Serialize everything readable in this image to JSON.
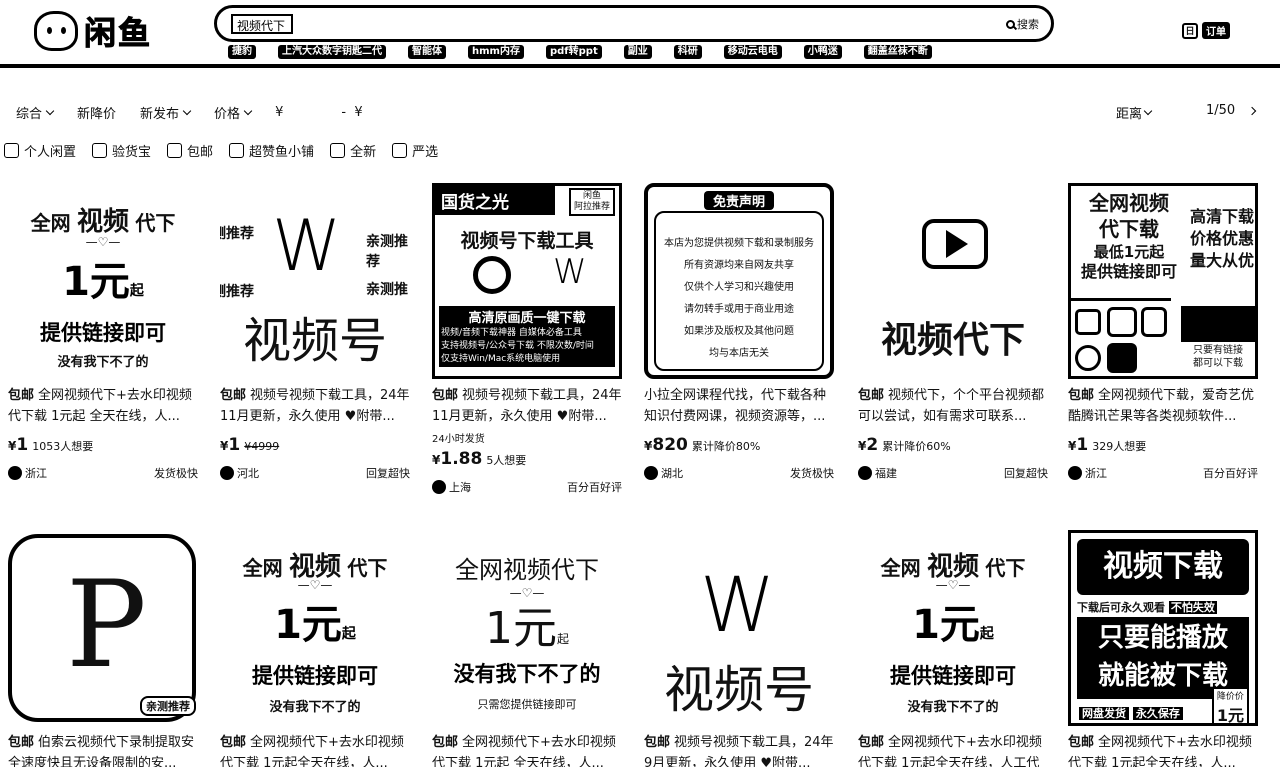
{
  "header": {
    "logo_text": "闲鱼",
    "search_value": "视频代下",
    "search_button": "搜索",
    "hot_words": [
      "捷豹",
      "上汽大众数字钥匙二代",
      "智能体",
      "hmm内存",
      "pdf转ppt",
      "副业",
      "科研",
      "移动云电电",
      "小鸭迷",
      "翻盖丝袜不断"
    ],
    "order_label": "订单"
  },
  "filters": {
    "sort_items": [
      "综合",
      "新降价",
      "新发布",
      "价格"
    ],
    "price_from": "¥",
    "price_sep": "-",
    "price_to": "¥",
    "distance": "距离",
    "page": "1/50",
    "checkboxes": [
      "个人闲置",
      "验货宝",
      "包邮",
      "超赞鱼小铺",
      "全新",
      "严选"
    ]
  },
  "products": [
    {
      "thumb": {
        "l1a": "全网",
        "l1b": "视频",
        "l1c": "代下",
        "l2": "1元",
        "l2s": "起",
        "l3": "提供链接即可",
        "l4": "没有我下不了的"
      },
      "tag": "包邮",
      "title": "全网视频代下+去水印视频代下载 1元起 全天在线，人...",
      "price": "1",
      "want": "1053人想要",
      "strike": "",
      "extra": "",
      "location": "浙江",
      "badge": "发货极快"
    },
    {
      "thumb": {
        "label1": "亲测推荐",
        "label2": "亲测推",
        "side1": "测推荐",
        "side2": "测推荐",
        "main": "视频号"
      },
      "tag": "包邮",
      "title": "视频号视频下载工具，24年11月更新，永久使用 ♥附带...",
      "price": "1",
      "want": "",
      "strike": "¥4999",
      "extra": "",
      "location": "河北",
      "badge": "回复超快"
    },
    {
      "thumb": {
        "top": "国货之光",
        "sub": "视频号下载工具",
        "hl": "高清原画质一键下载",
        "l1": "视频/音频下载神器 自媒体必备工具",
        "l2": "支持视频号/公众号下载 不限次数/时间",
        "l3": "仅支持Win/Mac系统电脑使用",
        "tag": "闲鱼",
        "tag2": "阿拉推荐"
      },
      "tag": "包邮",
      "title": "视频号视频下载工具，24年11月更新，永久使用 ♥附带...",
      "price": "1.88",
      "want": "5人想要",
      "strike": "",
      "extra": "24小时发货",
      "location": "上海",
      "badge": "百分百好评"
    },
    {
      "thumb": {
        "head": "免责声明",
        "lines": [
          "本店为您提供视频下载和录制服务",
          "所有资源均来自网友共享",
          "仅供个人学习和兴趣使用",
          "请勿转手或用于商业用途",
          "如果涉及版权及其他问题",
          "均与本店无关"
        ]
      },
      "tag": "",
      "title": "小拉全网课程代找，代下载各种知识付费网课，视频资源等，...",
      "price": "820",
      "want": "累计降价80%",
      "strike": "",
      "extra": "",
      "location": "湖北",
      "badge": "发货极快"
    },
    {
      "thumb": {
        "main": "视频代下"
      },
      "tag": "包邮",
      "title": "视频代下，个个平台视频都可以尝试，如有需求可联系...",
      "price": "2",
      "want": "累计降价60%",
      "strike": "",
      "extra": "",
      "location": "福建",
      "badge": "回复超快"
    },
    {
      "thumb": {
        "l1": "全网视频",
        "l2": "代下载",
        "l3": "最低1元起",
        "l4": "提供链接即可",
        "r1": "高清下载",
        "r2": "价格优惠",
        "r3": "量大从优",
        "r4": "只要有链接",
        "r5": "都可以下载"
      },
      "tag": "包邮",
      "title": "全网视频代下载，爱奇艺优酷腾讯芒果等各类视频软件...",
      "price": "1",
      "want": "329人想要",
      "strike": "",
      "extra": "",
      "location": "浙江",
      "badge": "百分百好评"
    },
    {
      "thumb": {
        "label": "亲测推荐"
      },
      "tag": "包邮",
      "title": "伯索云视频代下录制提取安全速度快且无设备限制的安...",
      "price": "",
      "want": "",
      "strike": "",
      "extra": "",
      "location": "",
      "badge": ""
    },
    {
      "thumb": {
        "l1a": "全网",
        "l1b": "视频",
        "l1c": "代下",
        "l2": "1元",
        "l2s": "起",
        "l3": "提供链接即可",
        "l4": "没有我下不了的"
      },
      "tag": "包邮",
      "title": "全网视频代下+去水印视频代下载 1元起全天在线，人...",
      "price": "",
      "want": "",
      "strike": "",
      "extra": "",
      "location": "",
      "badge": ""
    },
    {
      "thumb": {
        "l1": "全网视频代下",
        "l2": "1元",
        "l2s": "起",
        "l3": "没有我下不了的",
        "l4": "只需您提供链接即可"
      },
      "tag": "包邮",
      "title": "全网视频代下+去水印视频代下载 1元起 全天在线，人...",
      "price": "",
      "want": "",
      "strike": "",
      "extra": "",
      "location": "",
      "badge": ""
    },
    {
      "thumb": {
        "main": "视频号"
      },
      "tag": "包邮",
      "title": "视频号视频下载工具，24年9月更新，永久使用 ♥附带...",
      "price": "",
      "want": "",
      "strike": "",
      "extra": "",
      "location": "",
      "badge": ""
    },
    {
      "thumb": {
        "l1a": "全网",
        "l1b": "视频",
        "l1c": "代下",
        "l2": "1元",
        "l2s": "起",
        "l3": "提供链接即可",
        "l4": "没有我下不了的"
      },
      "tag": "包邮",
      "title": "全网视频代下+去水印视频代下载 1元起全天在线，人工代下...",
      "price": "",
      "want": "",
      "strike": "",
      "extra": "",
      "location": "",
      "badge": ""
    },
    {
      "thumb": {
        "l1": "视频下载",
        "l2": "下载后可永久观看",
        "l2b": "不怕失效",
        "l3": "只要能播放",
        "l4": "就能被下载",
        "l5": "网盘发货",
        "l6": "永久保存",
        "p1": "降价价",
        "p2": "1元"
      },
      "tag": "包邮",
      "title": "全网视频代下+去水印视频代下载 1元起全天在线，人...",
      "price": "",
      "want": "",
      "strike": "",
      "extra": "",
      "location": "",
      "badge": ""
    }
  ]
}
